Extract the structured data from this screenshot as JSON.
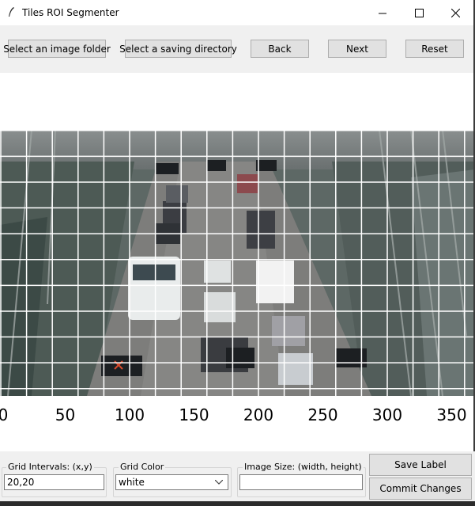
{
  "window": {
    "title": "Tiles ROI Segmenter",
    "minimize_icon": "minimize-icon",
    "maximize_icon": "maximize-icon",
    "close_icon": "close-icon"
  },
  "toolbar": {
    "select_folder": "Select an image folder",
    "select_saving": "Select a saving directory",
    "back": "Back",
    "next": "Next",
    "reset": "Reset"
  },
  "plot": {
    "x_ticks": [
      "0",
      "50",
      "100",
      "150",
      "200",
      "250",
      "300",
      "350"
    ],
    "x_tick_values": [
      0,
      50,
      100,
      150,
      200,
      250,
      300,
      350
    ],
    "grid_interval": [
      20,
      20
    ],
    "grid_color": "#ffffff",
    "marked_tile": "red-x-icon"
  },
  "controls": {
    "grid_intervals_label": "Grid Intervals: (x,y)",
    "grid_intervals_value": "20,20",
    "grid_color_label": "Grid Color",
    "grid_color_value": "white",
    "image_size_label": "Image Size: (width, height)",
    "image_size_value": "",
    "save_label": "Save Label",
    "commit_changes": "Commit Changes"
  }
}
